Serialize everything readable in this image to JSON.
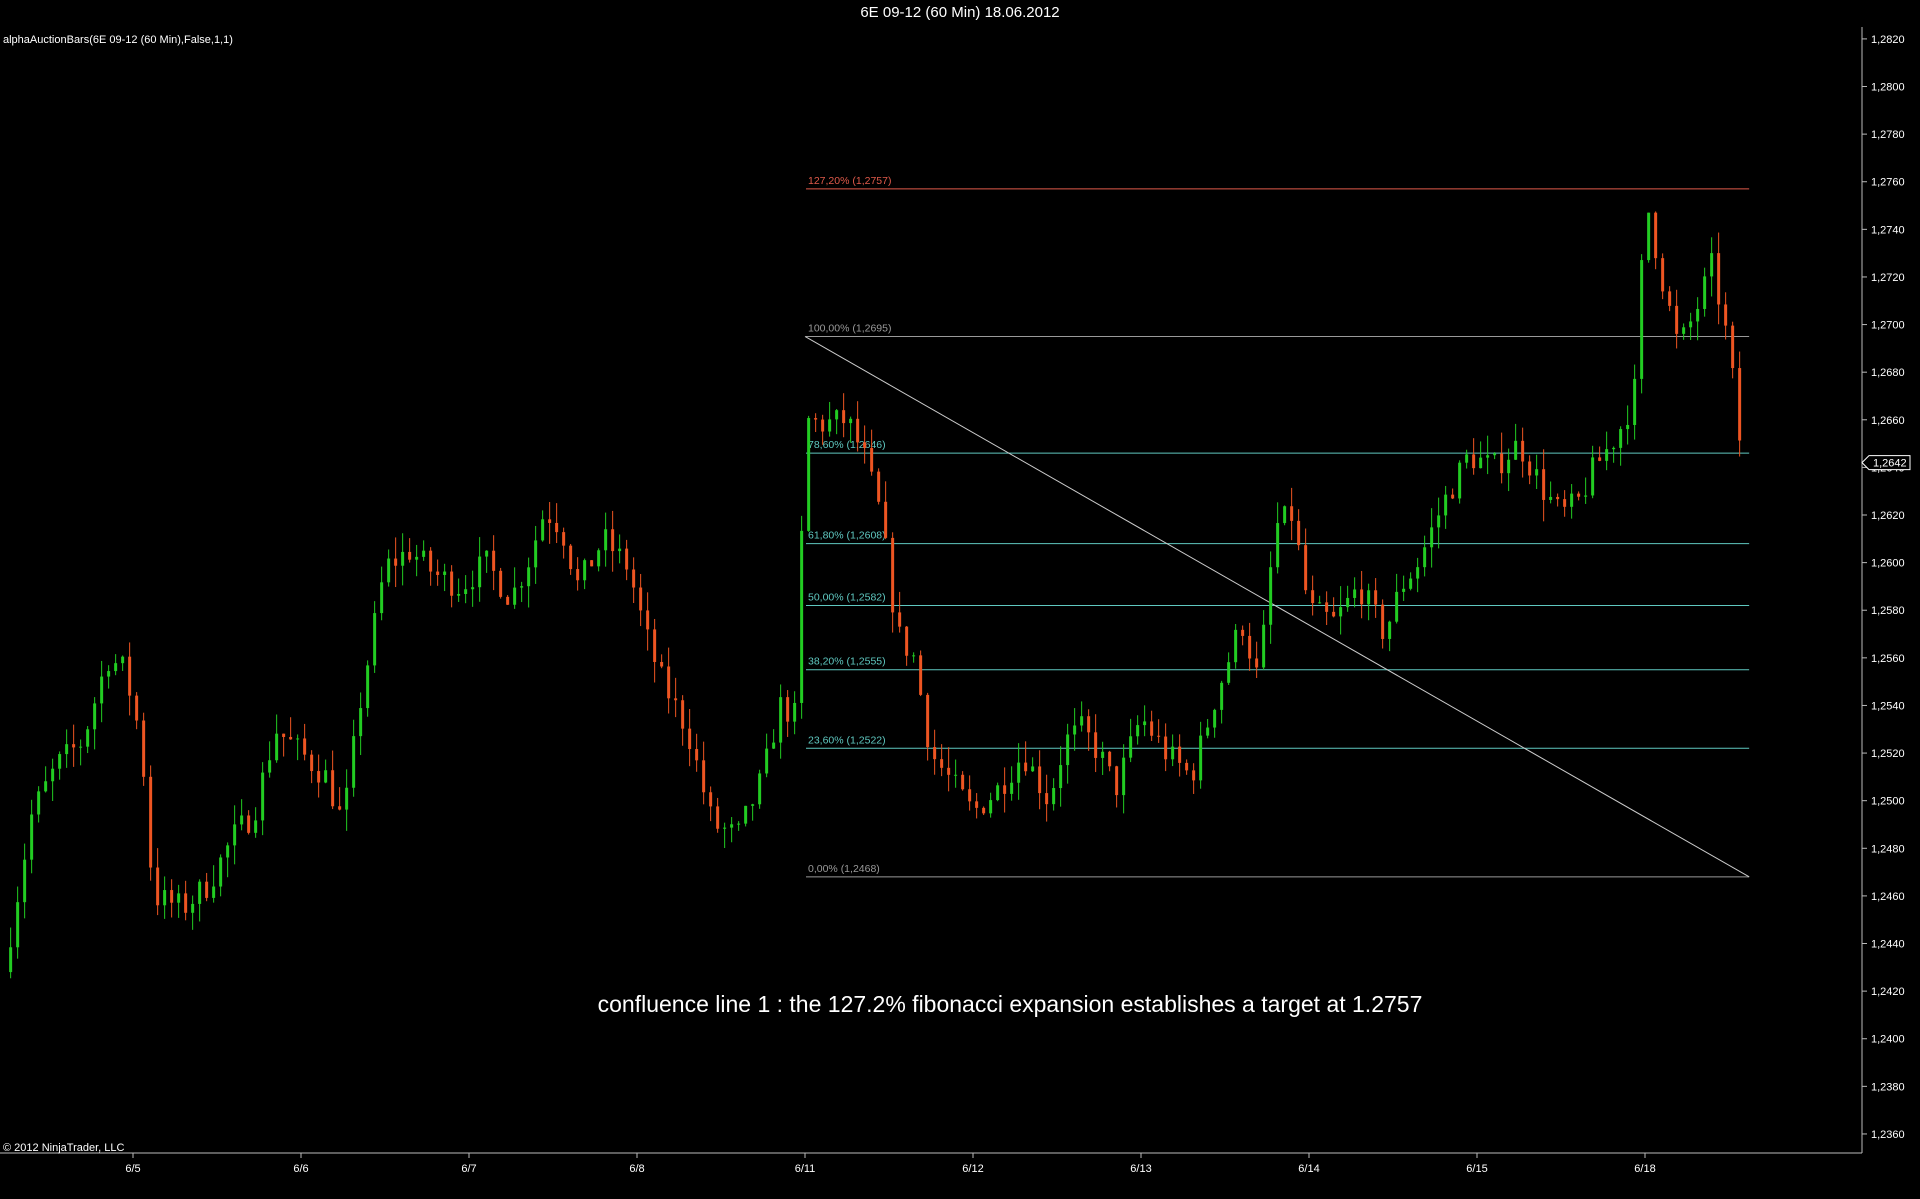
{
  "window": {
    "title": "6E 09-12 (60 Min)  18.06.2012"
  },
  "indicator_label": "alphaAuctionBars(6E 09-12 (60 Min),False,1,1)",
  "copyright": "© 2012 NinjaTrader, LLC",
  "annotation": "confluence line 1 : the 127.2% fibonacci expansion establishes a target at 1.2757",
  "colors": {
    "background": "#000000",
    "up_bar": "#22cc22",
    "down_bar": "#ee5522",
    "axis": "#bbbbbb",
    "fib_level": "#5fc8c0",
    "fib_extension": "#e05a4a",
    "fib_grey": "#999999"
  },
  "chart_data": {
    "type": "candlestick",
    "instrument": "6E 09-12",
    "timeframe": "60 Min",
    "ylim": [
      1.2352,
      1.2825
    ],
    "y_ticks": [
      "1,2360",
      "1,2380",
      "1,2400",
      "1,2420",
      "1,2440",
      "1,2460",
      "1,2480",
      "1,2500",
      "1,2520",
      "1,2540",
      "1,2560",
      "1,2580",
      "1,2600",
      "1,2620",
      "1,2640",
      "1,2660",
      "1,2680",
      "1,2700",
      "1,2720",
      "1,2740",
      "1,2760",
      "1,2780",
      "1,2800",
      "1,2820"
    ],
    "x_ticks": [
      {
        "label": "6/5",
        "day": 0
      },
      {
        "label": "6/6",
        "day": 1
      },
      {
        "label": "6/7",
        "day": 2
      },
      {
        "label": "6/8",
        "day": 3
      },
      {
        "label": "6/11",
        "day": 4
      },
      {
        "label": "6/12",
        "day": 5
      },
      {
        "label": "6/13",
        "day": 6
      },
      {
        "label": "6/14",
        "day": 7
      },
      {
        "label": "6/15",
        "day": 8
      },
      {
        "label": "6/18",
        "day": 9
      }
    ],
    "last_price_label": "1,2642",
    "last_price": 1.2642,
    "closes_start": 1.2428,
    "closes_start_day": -0.77,
    "bars_per_day": 24,
    "closes_anchors": [
      [
        -0.77,
        1.2428
      ],
      [
        -0.6,
        1.2495
      ],
      [
        -0.45,
        1.2515
      ],
      [
        -0.3,
        1.2525
      ],
      [
        -0.15,
        1.256
      ],
      [
        -0.05,
        1.2555
      ],
      [
        0.05,
        1.2525
      ],
      [
        0.12,
        1.246
      ],
      [
        0.3,
        1.2455
      ],
      [
        0.45,
        1.2465
      ],
      [
        0.6,
        1.2485
      ],
      [
        0.72,
        1.2495
      ],
      [
        0.85,
        1.253
      ],
      [
        1.0,
        1.252
      ],
      [
        1.15,
        1.251
      ],
      [
        1.25,
        1.249
      ],
      [
        1.35,
        1.254
      ],
      [
        1.5,
        1.2598
      ],
      [
        1.65,
        1.2605
      ],
      [
        1.8,
        1.2595
      ],
      [
        1.95,
        1.259
      ],
      [
        2.1,
        1.26
      ],
      [
        2.25,
        1.2585
      ],
      [
        2.35,
        1.26
      ],
      [
        2.45,
        1.2622
      ],
      [
        2.55,
        1.2615
      ],
      [
        2.65,
        1.259
      ],
      [
        2.8,
        1.261
      ],
      [
        2.95,
        1.2598
      ],
      [
        3.05,
        1.257
      ],
      [
        3.15,
        1.255
      ],
      [
        3.3,
        1.253
      ],
      [
        3.45,
        1.249
      ],
      [
        3.6,
        1.2485
      ],
      [
        3.75,
        1.251
      ],
      [
        3.85,
        1.254
      ],
      [
        3.95,
        1.2535
      ],
      [
        4.0,
        1.266
      ],
      [
        4.1,
        1.2658
      ],
      [
        4.25,
        1.266
      ],
      [
        4.35,
        1.2645
      ],
      [
        4.45,
        1.262
      ],
      [
        4.55,
        1.257
      ],
      [
        4.65,
        1.256
      ],
      [
        4.75,
        1.252
      ],
      [
        4.85,
        1.251
      ],
      [
        5.0,
        1.2495
      ],
      [
        5.15,
        1.2505
      ],
      [
        5.3,
        1.252
      ],
      [
        5.45,
        1.25
      ],
      [
        5.55,
        1.2525
      ],
      [
        5.65,
        1.253
      ],
      [
        5.75,
        1.252
      ],
      [
        5.85,
        1.2505
      ],
      [
        6.0,
        1.2535
      ],
      [
        6.15,
        1.252
      ],
      [
        6.3,
        1.251
      ],
      [
        6.45,
        1.2545
      ],
      [
        6.6,
        1.2575
      ],
      [
        6.7,
        1.255
      ],
      [
        6.8,
        1.2615
      ],
      [
        6.9,
        1.262
      ],
      [
        7.0,
        1.258
      ],
      [
        7.15,
        1.2575
      ],
      [
        7.3,
        1.259
      ],
      [
        7.45,
        1.257
      ],
      [
        7.55,
        1.259
      ],
      [
        7.65,
        1.26
      ],
      [
        7.8,
        1.2625
      ],
      [
        7.95,
        1.2645
      ],
      [
        8.1,
        1.264
      ],
      [
        8.25,
        1.265
      ],
      [
        8.4,
        1.263
      ],
      [
        8.5,
        1.262
      ],
      [
        8.6,
        1.2625
      ],
      [
        8.7,
        1.264
      ],
      [
        8.8,
        1.265
      ],
      [
        8.88,
        1.266
      ],
      [
        8.95,
        1.2675
      ],
      [
        9.0,
        1.2755
      ],
      [
        9.1,
        1.272
      ],
      [
        9.2,
        1.269
      ],
      [
        9.3,
        1.2705
      ],
      [
        9.4,
        1.2725
      ],
      [
        9.5,
        1.269
      ],
      [
        9.58,
        1.2642
      ]
    ],
    "fib_levels": [
      {
        "label": "127,20% (1,2757)",
        "value": 1.2757,
        "kind": "extension"
      },
      {
        "label": "100,00% (1,2695)",
        "value": 1.2695,
        "kind": "grey"
      },
      {
        "label": "78,60% (1,2646)",
        "value": 1.2646,
        "kind": "level"
      },
      {
        "label": "61,80% (1,2608)",
        "value": 1.2608,
        "kind": "level"
      },
      {
        "label": "50,00% (1,2582)",
        "value": 1.2582,
        "kind": "level"
      },
      {
        "label": "38,20% (1,2555)",
        "value": 1.2555,
        "kind": "level"
      },
      {
        "label": "23,60% (1,2522)",
        "value": 1.2522,
        "kind": "level"
      },
      {
        "label": "0,00% (1,2468)",
        "value": 1.2468,
        "kind": "grey"
      }
    ],
    "fib_range_days": [
      4.0,
      9.62
    ],
    "trend_line": {
      "from": [
        4.0,
        1.2695
      ],
      "to": [
        9.62,
        1.2468
      ]
    }
  }
}
